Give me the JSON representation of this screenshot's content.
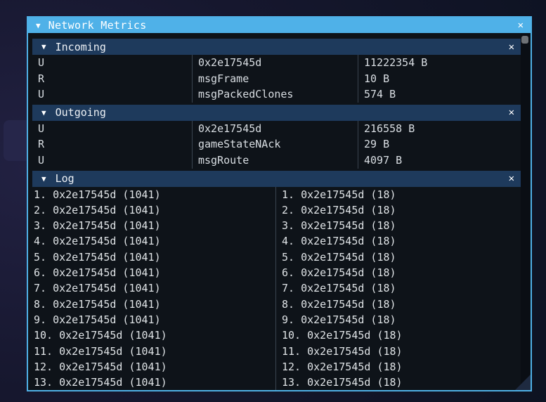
{
  "window": {
    "title": "Network Metrics",
    "collapse_glyph": "▼",
    "close_glyph": "✕"
  },
  "sections": {
    "incoming": {
      "title": "Incoming",
      "collapse_glyph": "▼",
      "close_glyph": "✕",
      "rows": [
        {
          "channel": "U",
          "name": "0x2e17545d",
          "size": "11222354 B"
        },
        {
          "channel": "R",
          "name": "msgFrame",
          "size": "10 B"
        },
        {
          "channel": "U",
          "name": "msgPackedClones",
          "size": "574 B"
        }
      ]
    },
    "outgoing": {
      "title": "Outgoing",
      "collapse_glyph": "▼",
      "close_glyph": "✕",
      "rows": [
        {
          "channel": "U",
          "name": "0x2e17545d",
          "size": "216558 B"
        },
        {
          "channel": "R",
          "name": "gameStateNAck",
          "size": "29 B"
        },
        {
          "channel": "U",
          "name": "msgRoute",
          "size": "4097 B"
        }
      ]
    },
    "log": {
      "title": "Log",
      "collapse_glyph": "▼",
      "close_glyph": "✕",
      "left_entries": [
        "1. 0x2e17545d (1041)",
        "2. 0x2e17545d (1041)",
        "3. 0x2e17545d (1041)",
        "4. 0x2e17545d (1041)",
        "5. 0x2e17545d (1041)",
        "6. 0x2e17545d (1041)",
        "7. 0x2e17545d (1041)",
        "8. 0x2e17545d (1041)",
        "9. 0x2e17545d (1041)",
        "10. 0x2e17545d (1041)",
        "11. 0x2e17545d (1041)",
        "12. 0x2e17545d (1041)",
        "13. 0x2e17545d (1041)"
      ],
      "right_entries": [
        "1. 0x2e17545d (18)",
        "2. 0x2e17545d (18)",
        "3. 0x2e17545d (18)",
        "4. 0x2e17545d (18)",
        "5. 0x2e17545d (18)",
        "6. 0x2e17545d (18)",
        "7. 0x2e17545d (18)",
        "8. 0x2e17545d (18)",
        "9. 0x2e17545d (18)",
        "10. 0x2e17545d (18)",
        "11. 0x2e17545d (18)",
        "12. 0x2e17545d (18)",
        "13. 0x2e17545d (18)"
      ]
    }
  },
  "colors": {
    "titlebar": "#4fb1e8",
    "window_border": "#4fb0e6",
    "section_header": "#1e3a5c",
    "content_bg": "#0e1319",
    "row_text": "#d9dee3",
    "divider": "#3a4450",
    "scroll_thumb": "#6e7276"
  }
}
